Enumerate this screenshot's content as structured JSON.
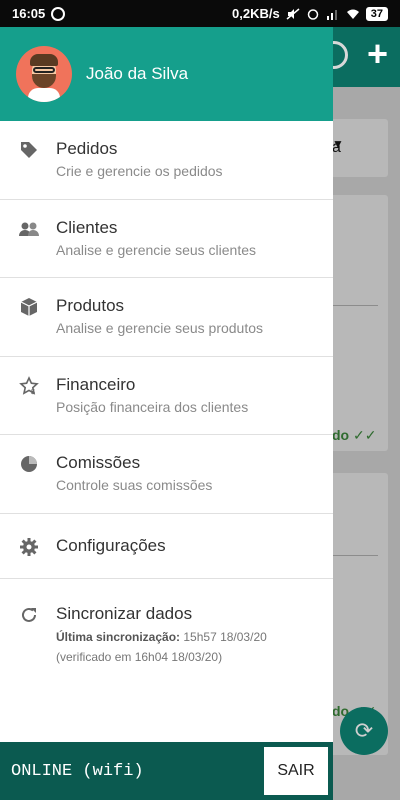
{
  "status_bar": {
    "time": "16:05",
    "speed": "0,2KB/s",
    "battery": "37"
  },
  "background": {
    "select_value": "a",
    "card1_status": "do",
    "card2_status": "do"
  },
  "drawer": {
    "user_name": "João da Silva",
    "items": [
      {
        "title": "Pedidos",
        "subtitle": "Crie e gerencie os pedidos",
        "icon": "tag-icon"
      },
      {
        "title": "Clientes",
        "subtitle": "Analise e gerencie seus clientes",
        "icon": "people-icon"
      },
      {
        "title": "Produtos",
        "subtitle": "Analise e gerencie seus produtos",
        "icon": "box-icon"
      },
      {
        "title": "Financeiro",
        "subtitle": "Posição financeira dos clientes",
        "icon": "star-icon"
      },
      {
        "title": "Comissões",
        "subtitle": "Controle suas comissões",
        "icon": "pie-chart-icon"
      },
      {
        "title": "Configurações",
        "icon": "gear-icon"
      },
      {
        "title": "Sincronizar dados",
        "icon": "sync-icon"
      }
    ],
    "sync": {
      "last_label": "Última sincronização:",
      "last_value": "15h57 18/03/20",
      "verified": "(verificado em 16h04 18/03/20)"
    }
  },
  "footer": {
    "status": "ONLINE (wifi)",
    "logout_label": "SAIR"
  }
}
